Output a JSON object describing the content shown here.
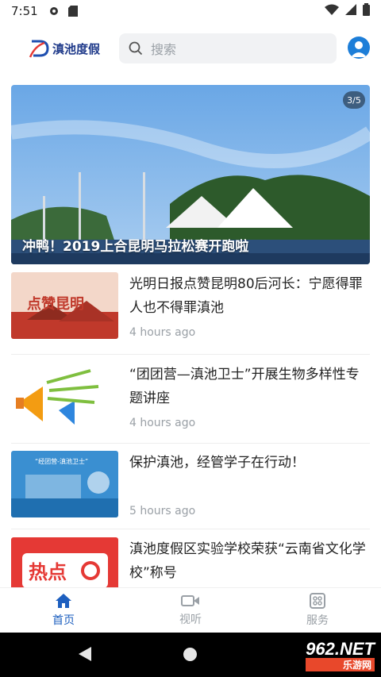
{
  "status_bar": {
    "time": "7:51"
  },
  "header": {
    "logo_text": "滇池度假",
    "search_placeholder": "搜索"
  },
  "banner": {
    "badge": "3/5",
    "title": "冲鸭！2019上合昆明马拉松赛开跑啦"
  },
  "news": [
    {
      "title": "光明日报点赞昆明80后河长：宁愿得罪人也不得罪滇池",
      "time": "4 hours ago",
      "thumb_text": "点赞昆明"
    },
    {
      "title": "“团团营—滇池卫士”开展生物多样性专题讲座",
      "time": "4 hours ago"
    },
    {
      "title": "保护滇池，经管学子在行动！",
      "time": "5 hours ago",
      "thumb_text": "“经团营-滇池卫士”"
    },
    {
      "title": "滇池度假区实验学校荣获“云南省文化学校”称号",
      "time": "",
      "thumb_text": "热点"
    }
  ],
  "tabs": [
    {
      "label": "首页",
      "active": true,
      "icon": "home-icon"
    },
    {
      "label": "视听",
      "active": false,
      "icon": "video-icon"
    },
    {
      "label": "服务",
      "active": false,
      "icon": "service-icon"
    }
  ],
  "watermark": {
    "main": "962.NET",
    "sub": "乐游网"
  },
  "colors": {
    "accent": "#1d5fbf",
    "inactive": "#9aa0a6"
  }
}
